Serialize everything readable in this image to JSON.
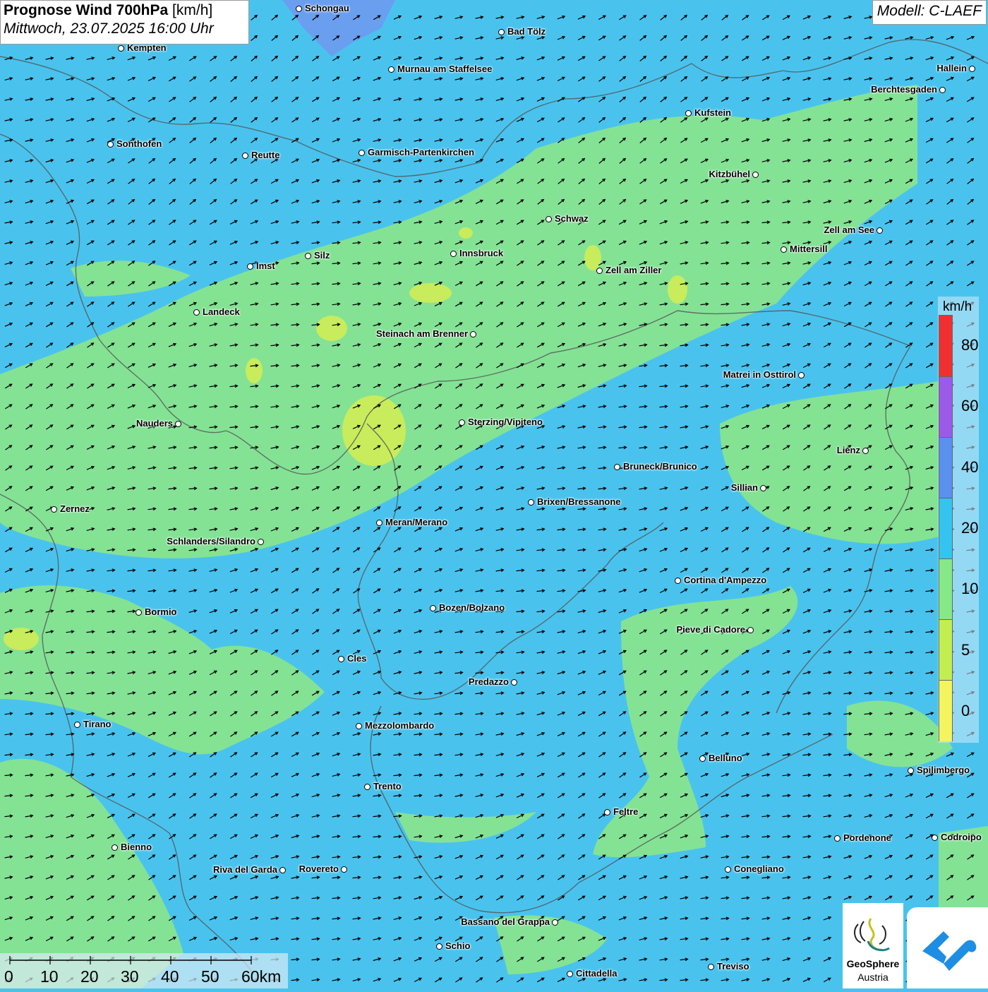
{
  "header": {
    "title": "Prognose Wind 700hPa",
    "unit": "[km/h]",
    "datetime": "Mittwoch, 23.07.2025 16:00 Uhr",
    "model": "Modell: C-LAEF"
  },
  "legend": {
    "unit": "km/h",
    "ticks": [
      "80",
      "60",
      "40",
      "20",
      "10",
      "5",
      "0"
    ],
    "colors": [
      "#f03030",
      "#9b5be8",
      "#5a90ee",
      "#34c4ef",
      "#86e887",
      "#c2ee50",
      "#f4f45e"
    ]
  },
  "scalebar": {
    "labels": [
      "0",
      "10",
      "20",
      "30",
      "40",
      "50",
      "60km"
    ]
  },
  "logos": {
    "geosphere_line1": "GeoSphere",
    "geosphere_line2": "Austria"
  },
  "cities": [
    {
      "name": "Schongau",
      "label": "Schongau"
    },
    {
      "name": "Bad Tölz",
      "label": "Bad Tölz"
    },
    {
      "name": "Kempten",
      "label": "Kempten"
    },
    {
      "name": "Murnau am Staffelsee",
      "label": "Murnau am Staffelsee"
    },
    {
      "name": "Hallein",
      "label": "Hallein"
    },
    {
      "name": "Berchtesgaden",
      "label": "Berchtesgaden"
    },
    {
      "name": "Kufstein",
      "label": "Kufstein"
    },
    {
      "name": "Sonthofen",
      "label": "Sonthofen"
    },
    {
      "name": "Reutte",
      "label": "Reutte"
    },
    {
      "name": "Garmisch-Partenkirchen",
      "label": "Garmisch-Partenkirchen"
    },
    {
      "name": "Kitzbühel",
      "label": "Kitzbühel"
    },
    {
      "name": "Schwaz",
      "label": "Schwaz"
    },
    {
      "name": "Zell am See",
      "label": "Zell am See"
    },
    {
      "name": "Mittersill",
      "label": "Mittersill"
    },
    {
      "name": "Innsbruck",
      "label": "Innsbruck"
    },
    {
      "name": "Silz",
      "label": "Silz"
    },
    {
      "name": "Imst",
      "label": "Imst"
    },
    {
      "name": "Zell am Ziller",
      "label": "Zell am Ziller"
    },
    {
      "name": "Landeck",
      "label": "Landeck"
    },
    {
      "name": "Steinach am Brenner",
      "label": "Steinach am Brenner"
    },
    {
      "name": "Matrei in Osttirol",
      "label": "Matrei in Osttirol"
    },
    {
      "name": "Nauders",
      "label": "Nauders"
    },
    {
      "name": "Sterzing/Vipiteno",
      "label": "Sterzing/Vipiteno"
    },
    {
      "name": "Lienz",
      "label": "Lienz"
    },
    {
      "name": "Bruneck/Brunico",
      "label": "Bruneck/Brunico"
    },
    {
      "name": "Sillian",
      "label": "Sillian"
    },
    {
      "name": "Zernez",
      "label": "Zernez"
    },
    {
      "name": "Brixen/Bressanone",
      "label": "Brixen/Bressanone"
    },
    {
      "name": "Meran/Merano",
      "label": "Meran/Merano"
    },
    {
      "name": "Schlanders/Silandro",
      "label": "Schlanders/Silandro"
    },
    {
      "name": "Cortina d'Ampezzo",
      "label": "Cortina d'Ampezzo"
    },
    {
      "name": "Bozen/Bolzano",
      "label": "Bozen/Bolzano"
    },
    {
      "name": "Bormio",
      "label": "Bormio"
    },
    {
      "name": "Pieve di Cadore",
      "label": "Pieve di Cadore"
    },
    {
      "name": "Cles",
      "label": "Cles"
    },
    {
      "name": "Predazzo",
      "label": "Predazzo"
    },
    {
      "name": "Tirano",
      "label": "Tirano"
    },
    {
      "name": "Mezzolombardo",
      "label": "Mezzolombardo"
    },
    {
      "name": "Belluno",
      "label": "Belluno"
    },
    {
      "name": "Spilimbergo",
      "label": "Spilimbergo"
    },
    {
      "name": "Trento",
      "label": "Trento"
    },
    {
      "name": "Feltre",
      "label": "Feltre"
    },
    {
      "name": "Pordenone",
      "label": "Pordenone"
    },
    {
      "name": "Codroipo",
      "label": "Codroipo"
    },
    {
      "name": "Bienno",
      "label": "Bienno"
    },
    {
      "name": "Riva del Garda",
      "label": "Riva del Garda"
    },
    {
      "name": "Rovereto",
      "label": "Rovereto"
    },
    {
      "name": "Conegliano",
      "label": "Conegliano"
    },
    {
      "name": "Bassano del Grappa",
      "label": "Bassano del Grappa"
    },
    {
      "name": "Schio",
      "label": "Schio"
    },
    {
      "name": "Treviso",
      "label": "Treviso"
    },
    {
      "name": "Cittadella",
      "label": "Cittadella"
    }
  ]
}
